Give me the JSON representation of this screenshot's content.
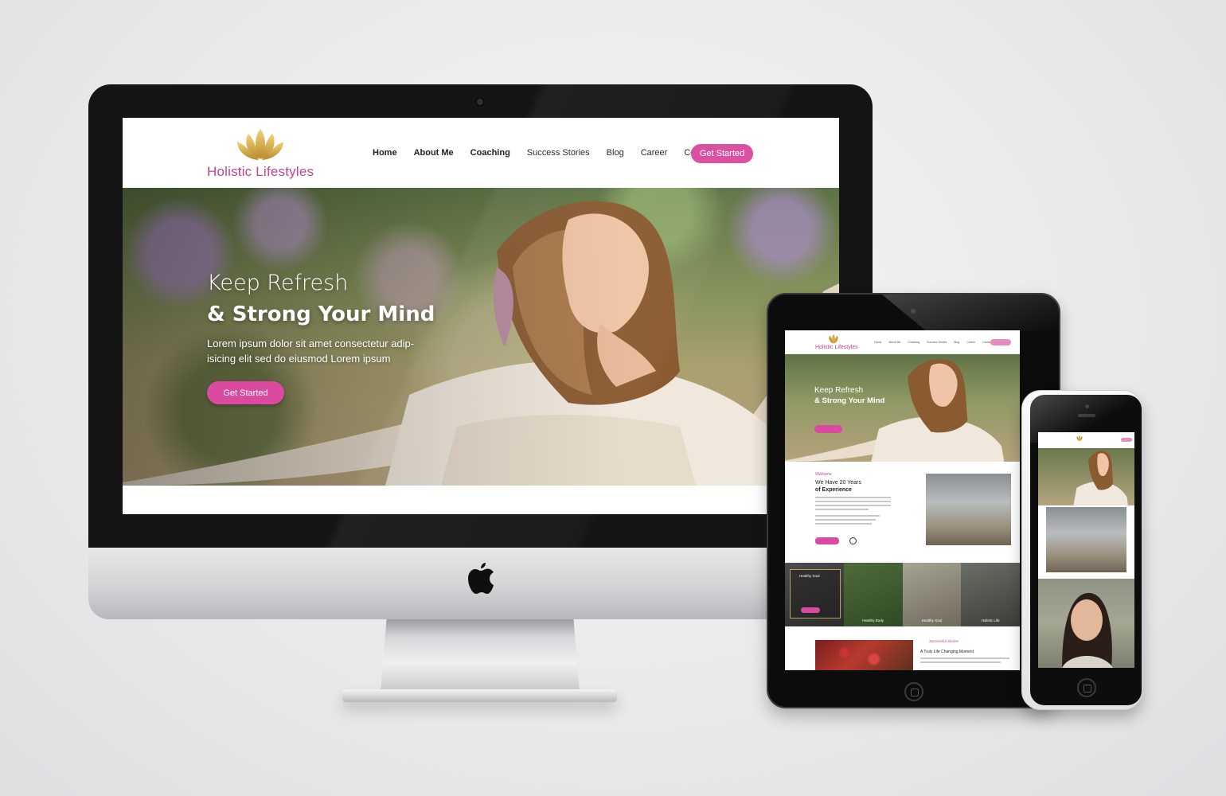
{
  "desktop": {
    "brand": "Holistic Lifestyles",
    "nav": [
      "Home",
      "About Me",
      "Coaching",
      "Success Stories",
      "Blog",
      "Career",
      "Contact"
    ],
    "header_cta": "Get Started",
    "hero": {
      "title_line1": "Keep Refresh",
      "title_line2": "& Strong Your Mind",
      "text": "Lorem ipsum dolor sit amet consectetur adip-isicing elit sed do eiusmod Lorem ipsum",
      "cta": "Get Started"
    }
  },
  "tablet": {
    "brand": "Holistic Lifestyles",
    "nav": [
      "Home",
      "About Me",
      "Coaching",
      "Success Stories",
      "Blog",
      "Career",
      "Contact"
    ],
    "hero": {
      "title_line1": "Keep Refresh",
      "title_line2": "& Strong Your Mind"
    },
    "about": {
      "tag": "Welcome",
      "title_line1": "We Have 20 Years",
      "title_line2": "of Experience"
    },
    "tiles": [
      {
        "label": "Healthy Soul"
      },
      {
        "label": "Healthy Body"
      },
      {
        "label": "Healthy Soul"
      },
      {
        "label": "Holistic Life"
      }
    ],
    "stories": {
      "tag": "Successful Stories",
      "title": "A Truly Life Changing Moment"
    }
  },
  "colors": {
    "accent": "#d94aa0",
    "brand_text": "#c0458d",
    "gold": "#d7b04a"
  },
  "icons": {
    "logo": "lotus-icon",
    "device_logo": "apple-logo-icon"
  }
}
